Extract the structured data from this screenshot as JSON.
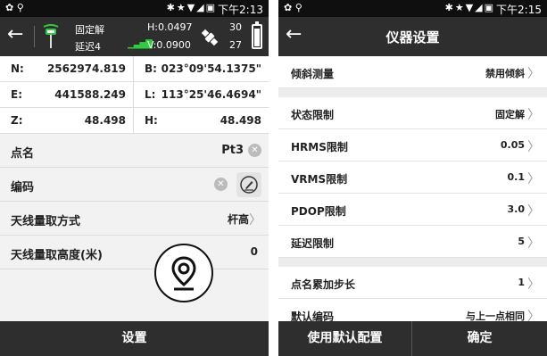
{
  "left": {
    "statusbar": {
      "time": "下午2:13"
    },
    "header": {
      "fix_status": "固定解",
      "delay_label": "延迟4",
      "h_precision": "H:0.0497",
      "v_precision": "V:0.0900",
      "satellites_a": "30",
      "satellites_b": "27",
      "battery_level": 0.9
    },
    "coords": [
      {
        "label": "N:",
        "value": "2562974.819"
      },
      {
        "label": "B:",
        "value": "023°09'54.1375\""
      },
      {
        "label": "E:",
        "value": "441588.249"
      },
      {
        "label": "L:",
        "value": "113°25'46.4694\""
      },
      {
        "label": "Z:",
        "value": "48.498"
      },
      {
        "label": "H:",
        "value": "48.498"
      }
    ],
    "form": {
      "point_name_label": "点名",
      "point_name_value": "Pt3",
      "code_label": "编码",
      "antenna_method_label": "天线量取方式",
      "antenna_method_value": "杆高",
      "antenna_height_label": "天线量取高度(米)",
      "antenna_height_value": "0"
    },
    "bottom_button": "设置"
  },
  "right": {
    "statusbar": {
      "time": "下午2:15"
    },
    "title": "仪器设置",
    "settings": [
      {
        "label": "倾斜测量",
        "value": "禁用倾斜"
      },
      {
        "label": "状态限制",
        "value": "固定解"
      },
      {
        "label": "HRMS限制",
        "value": "0.05"
      },
      {
        "label": "VRMS限制",
        "value": "0.1"
      },
      {
        "label": "PDOP限制",
        "value": "3.0"
      },
      {
        "label": "延迟限制",
        "value": "5"
      },
      {
        "label": "点名累加步长",
        "value": "1"
      },
      {
        "label": "默认编码",
        "value": "与上一点相同"
      }
    ],
    "buttons": {
      "defaults": "使用默认配置",
      "confirm": "确定"
    }
  }
}
